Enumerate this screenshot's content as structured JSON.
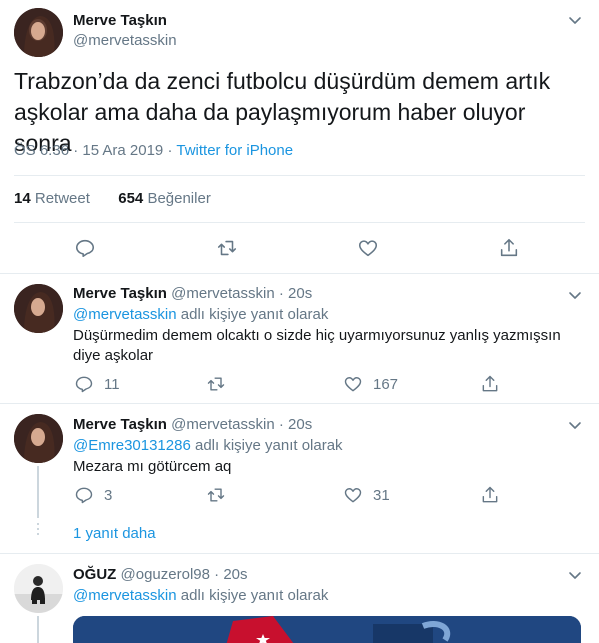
{
  "main_tweet": {
    "author_name": "Merve Taşkın",
    "author_handle": "@mervetasskin",
    "text": "Trabzon’da da zenci futbolcu düşürdüm demem artık aşkolar ama daha da paylaşmıyorum haber oluyor sonra",
    "time": "ÖS 6:36 · 15 Ara 2019",
    "source": "Twitter for iPhone",
    "retweet_count": "14",
    "retweet_label": "Retweet",
    "like_count": "654",
    "like_label": "Beğeniler"
  },
  "replies": [
    {
      "author_name": "Merve Taşkın",
      "author_handle": "@mervetasskin",
      "time_ago": "20s",
      "reply_to_handle": "@mervetasskin",
      "reply_to_suffix": "adlı kişiye yanıt olarak",
      "text": "Düşürmedim demem olcaktı o sizde hiç uyarmıyorsunuz yanlış yazmışsın diye aşkolar",
      "reply_count": "11",
      "like_count": "167"
    },
    {
      "author_name": "Merve Taşkın",
      "author_handle": "@mervetasskin",
      "time_ago": "20s",
      "reply_to_handle": "@Emre30131286",
      "reply_to_suffix": "adlı kişiye yanıt olarak",
      "text": "Mezara mı götürcem aq",
      "reply_count": "3",
      "like_count": "31"
    },
    {
      "author_name": "OĞUZ",
      "author_handle": "@oguzerol98",
      "time_ago": "20s",
      "reply_to_handle": "@mervetasskin",
      "reply_to_suffix": "adlı kişiye yanıt olarak"
    }
  ],
  "more_replies_label": "1 yanıt daha",
  "colors": {
    "text": "#14171a",
    "secondary": "#657786",
    "link": "#1b95e0",
    "divider": "#e6ecf0"
  },
  "icons": [
    "reply-icon",
    "retweet-icon",
    "like-icon",
    "share-icon",
    "chevron-down-icon"
  ]
}
